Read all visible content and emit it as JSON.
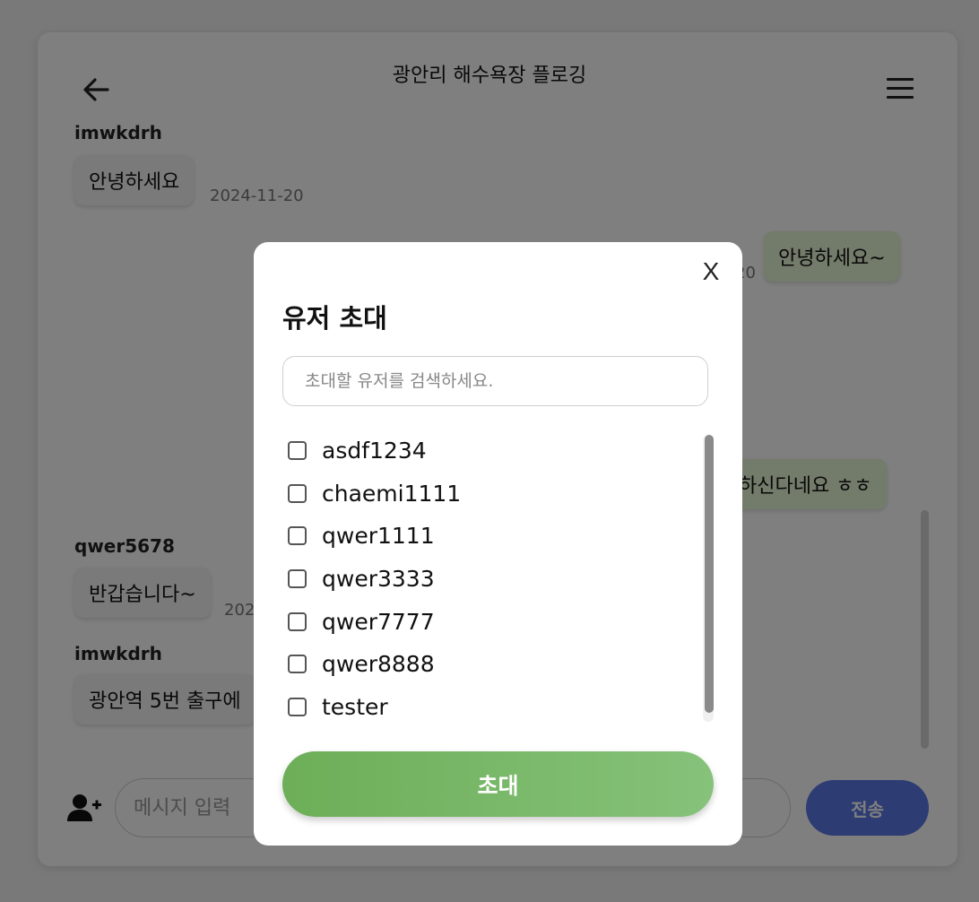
{
  "header": {
    "title": "광안리 해수욕장 플로깅",
    "back_icon": "arrow-left-icon",
    "menu_icon": "hamburger-menu-icon"
  },
  "messages": [
    {
      "sender": "imwkdrh",
      "text": "안녕하세요",
      "date": "2024-11-20",
      "mine": false
    },
    {
      "sender": "",
      "text": "안녕하세요~",
      "date": "20",
      "mine": true
    },
    {
      "sender": "",
      "text": "하신다네요 ㅎㅎ",
      "date": "",
      "mine": true
    },
    {
      "sender": "qwer5678",
      "text": "반갑습니다~",
      "date": "202",
      "mine": false
    },
    {
      "sender": "imwkdrh",
      "text": "광안역 5번 출구에",
      "date": "",
      "mine": false
    }
  ],
  "composer": {
    "add_user_icon": "add-user-icon",
    "placeholder": "메시지 입력",
    "send_label": "전송",
    "send_color": "#5b79e6"
  },
  "invite_modal": {
    "close_label": "X",
    "title": "유저 초대",
    "search_placeholder": "초대할 유저를 검색하세요.",
    "users": [
      {
        "name": "asdf1234",
        "checked": false
      },
      {
        "name": "chaemi1111",
        "checked": false
      },
      {
        "name": "qwer1111",
        "checked": false
      },
      {
        "name": "qwer3333",
        "checked": false
      },
      {
        "name": "qwer7777",
        "checked": false
      },
      {
        "name": "qwer8888",
        "checked": false
      },
      {
        "name": "tester",
        "checked": false
      }
    ],
    "invite_label": "초대",
    "invite_color": "#6dae58"
  }
}
